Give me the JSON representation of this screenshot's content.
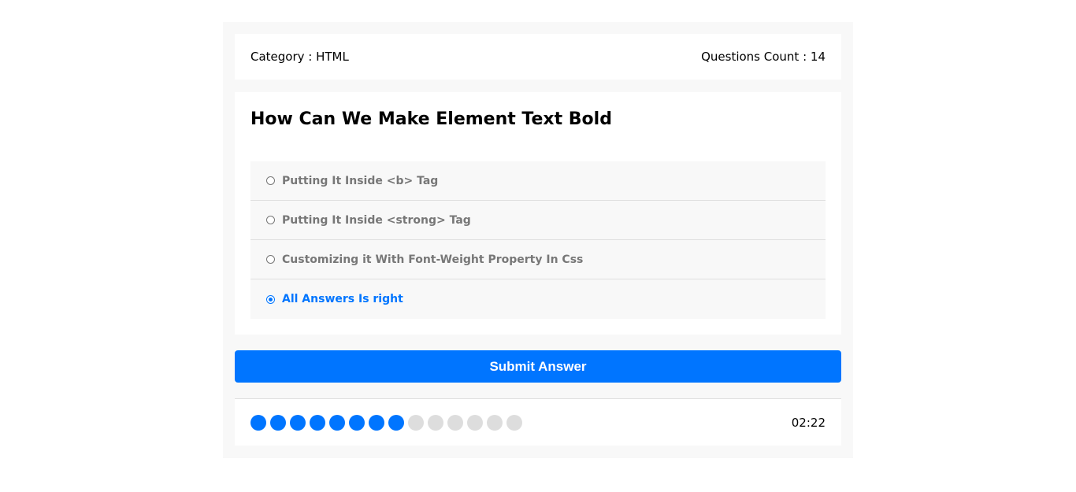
{
  "info": {
    "category_label": "Category : HTML",
    "count_label": "Questions Count : 14"
  },
  "question": {
    "title": "How Can We Make Element Text Bold",
    "answers": [
      {
        "label": "Putting It Inside <b> Tag",
        "checked": false
      },
      {
        "label": "Putting It Inside <strong> Tag",
        "checked": false
      },
      {
        "label": "Customizing it With Font-Weight Property In Css",
        "checked": false
      },
      {
        "label": "All Answers Is right",
        "checked": true
      }
    ]
  },
  "submit_label": "Submit Answer",
  "progress": {
    "bullets_total": 14,
    "bullets_on": 8
  },
  "countdown": "02:22",
  "colors": {
    "accent": "#0075ff",
    "bullet_off": "#dddddd",
    "panel": "#f8f8f8"
  }
}
